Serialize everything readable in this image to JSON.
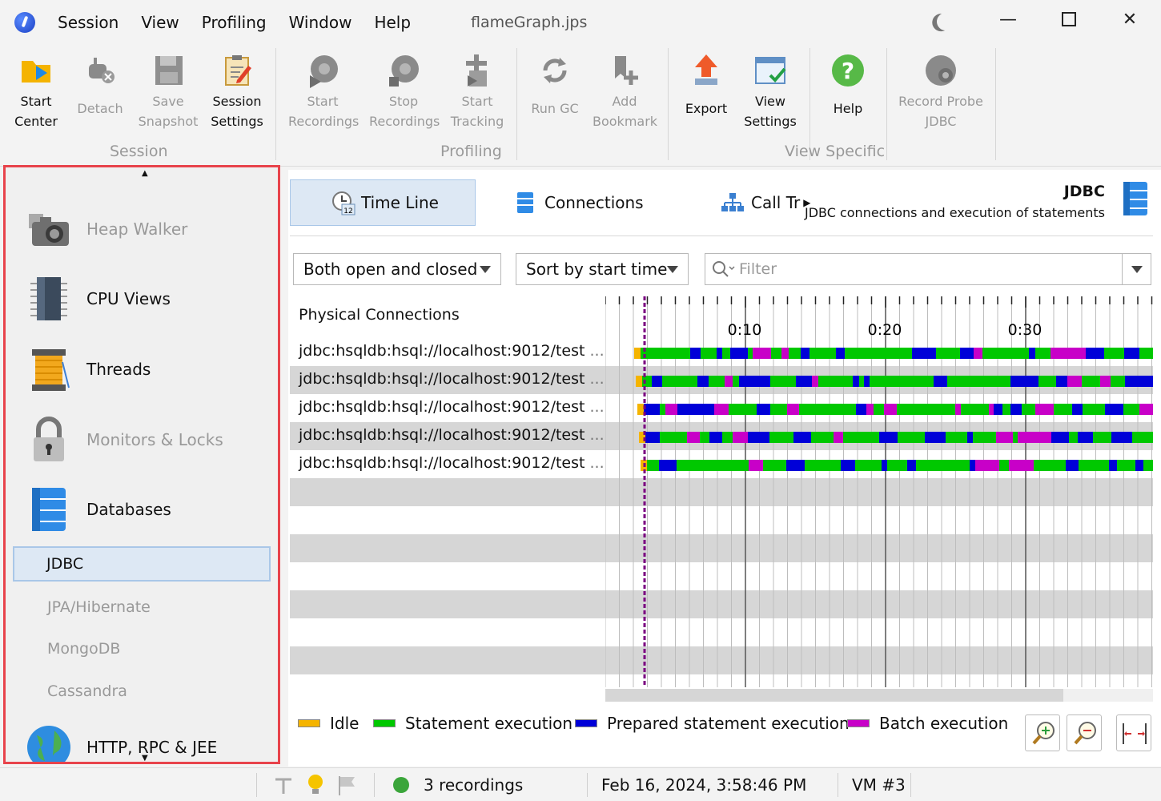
{
  "window": {
    "title": "flameGraph.jps",
    "menu": [
      "Session",
      "View",
      "Profiling",
      "Window",
      "Help"
    ]
  },
  "ribbon": {
    "session": {
      "group_label": "Session",
      "buttons": [
        {
          "label1": "Start",
          "label2": "Center",
          "enabled": true
        },
        {
          "label1": "Detach",
          "label2": "",
          "enabled": false
        },
        {
          "label1": "Save",
          "label2": "Snapshot",
          "enabled": false
        },
        {
          "label1": "Session",
          "label2": "Settings",
          "enabled": true
        }
      ]
    },
    "profiling": {
      "group_label": "Profiling",
      "buttons": [
        {
          "label1": "Start",
          "label2": "Recordings",
          "enabled": false
        },
        {
          "label1": "Stop",
          "label2": "Recordings",
          "enabled": false
        },
        {
          "label1": "Start",
          "label2": "Tracking",
          "enabled": false
        },
        {
          "label1": "Run GC",
          "label2": "",
          "enabled": false
        },
        {
          "label1": "Add",
          "label2": "Bookmark",
          "enabled": false
        }
      ]
    },
    "view_specific": {
      "group_label": "View Specific",
      "buttons": [
        {
          "label1": "Export",
          "label2": "",
          "enabled": true
        },
        {
          "label1": "View",
          "label2": "Settings",
          "enabled": true
        },
        {
          "label1": "Help",
          "label2": "",
          "enabled": true
        },
        {
          "label1": "Record Probe",
          "label2": "JDBC",
          "enabled": false
        }
      ]
    }
  },
  "leftnav": {
    "items": [
      {
        "label": "Heap Walker",
        "enabled": false
      },
      {
        "label": "CPU Views",
        "enabled": true
      },
      {
        "label": "Threads",
        "enabled": true
      },
      {
        "label": "Monitors & Locks",
        "enabled": false
      },
      {
        "label": "Databases",
        "enabled": true
      }
    ],
    "sub_items": [
      "JDBC",
      "JPA/Hibernate",
      "MongoDB",
      "Cassandra"
    ],
    "last_item": "HTTP, RPC & JEE"
  },
  "view": {
    "tabs": [
      "Time Line",
      "Connections",
      "Call Tr"
    ],
    "title": "JDBC",
    "description": "JDBC connections and execution of statements",
    "combo_state": "Both open and closed",
    "combo_sort": "Sort by start time",
    "filter_placeholder": "Filter",
    "tree_header": "Physical Connections",
    "connections": [
      "jdbc:hsqldb:hsql://localhost:9012/test",
      "jdbc:hsqldb:hsql://localhost:9012/test",
      "jdbc:hsqldb:hsql://localhost:9012/test",
      "jdbc:hsqldb:hsql://localhost:9012/test",
      "jdbc:hsqldb:hsql://localhost:9012/test"
    ],
    "ellipsis": "...",
    "time_labels": [
      "0:10",
      "0:20",
      "0:30"
    ],
    "legend": [
      {
        "label": "Idle",
        "color": "#f5b400"
      },
      {
        "label": "Statement execution",
        "color": "#00c800"
      },
      {
        "label": "Prepared statement execution",
        "color": "#0000d8"
      },
      {
        "label": "Batch execution",
        "color": "#c800c8"
      }
    ]
  },
  "status": {
    "recordings": "3 recordings",
    "datetime": "Feb 16, 2024, 3:58:46 PM",
    "vm": "VM #3"
  }
}
